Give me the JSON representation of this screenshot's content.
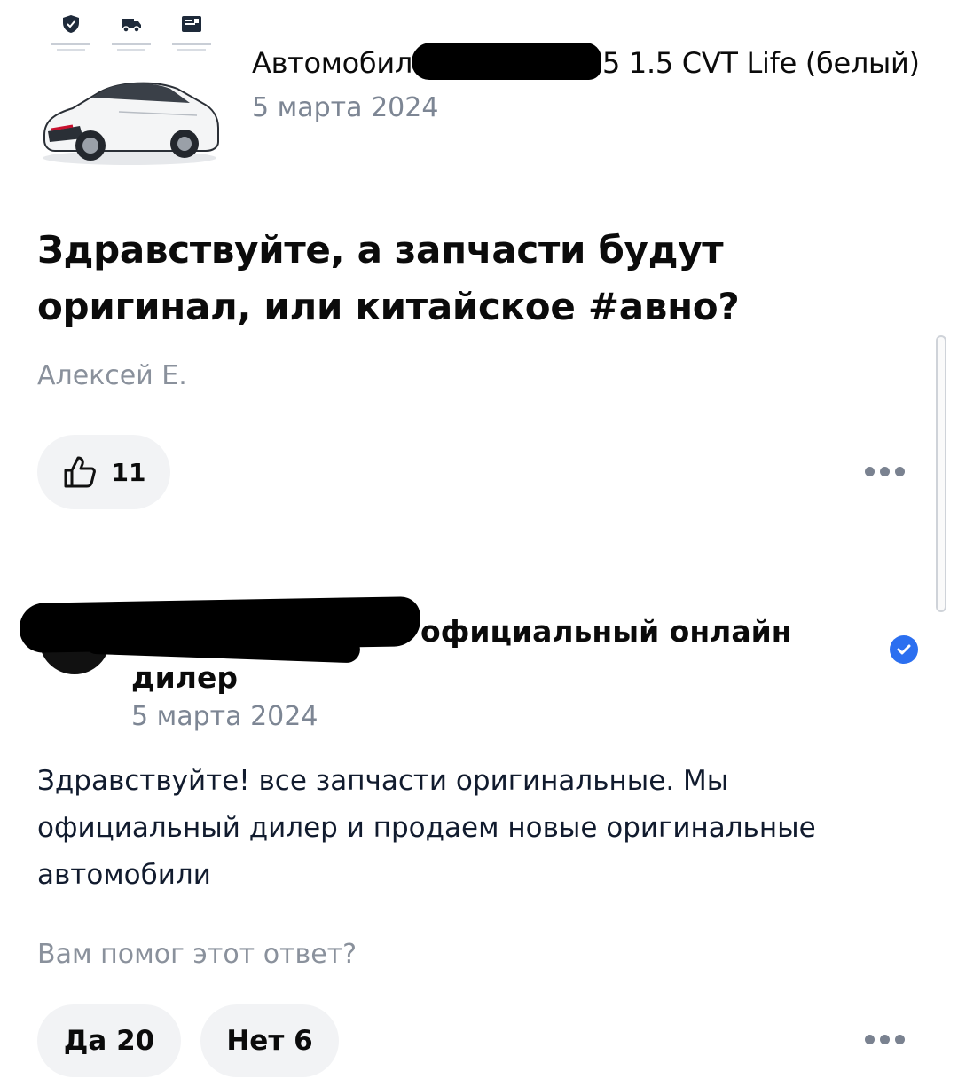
{
  "product": {
    "title_prefix": "Автомобил",
    "title_suffix": "5 1.5 CVT Life (белый)",
    "date": "5 марта 2024",
    "badge_icons": [
      "shield-check-icon",
      "delivery-truck-icon",
      "document-icon"
    ]
  },
  "question": {
    "text": "Здравствуйте, а запчасти будут оригинал, или китайское #авно?",
    "author": "Алексей Е.",
    "likes": "11"
  },
  "answer": {
    "name_visible": "официальный онлайн дилер",
    "verified": true,
    "date": "5 марта 2024",
    "text": "Здравствуйте! все запчасти оригинальные. Мы официальный дилер и продаем новые оригинальные автомобили",
    "helpful_question": "Вам помог этот ответ?",
    "yes_label": "Да 20",
    "no_label": "Нет 6"
  },
  "colors": {
    "accent": "#2b6ff0",
    "pill_bg": "#f2f3f5",
    "muted_text": "#7d8694"
  }
}
